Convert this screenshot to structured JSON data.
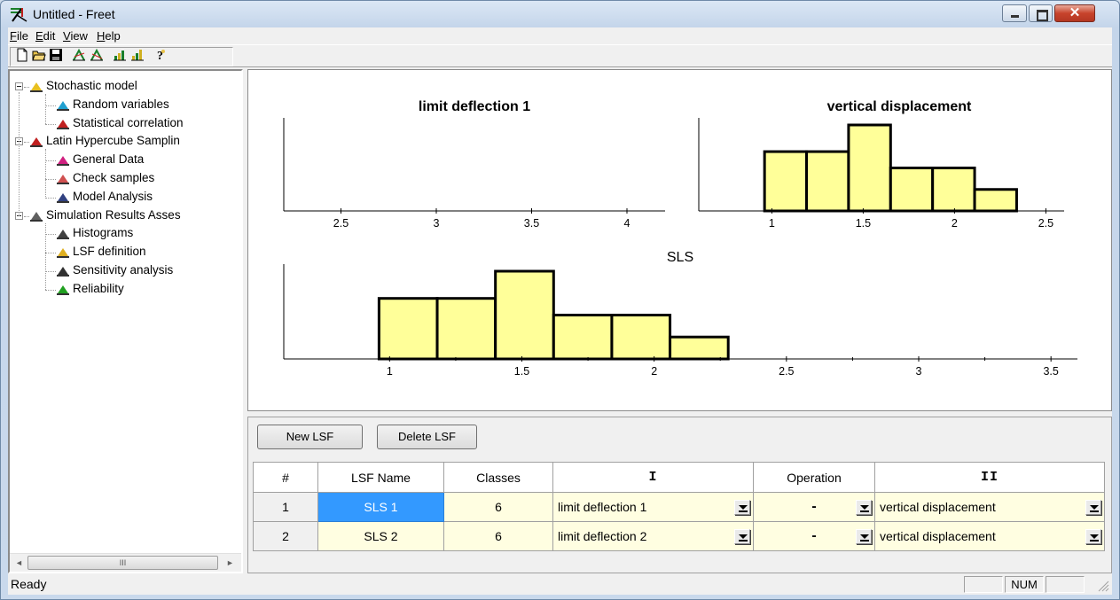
{
  "window": {
    "title": "Untitled - Freet"
  },
  "menu": [
    {
      "label": "File",
      "key": "F",
      "rest": "ile"
    },
    {
      "label": "Edit",
      "key": "E",
      "rest": "dit"
    },
    {
      "label": "View",
      "key": "V",
      "rest": "iew"
    },
    {
      "label": "Help",
      "key": "H",
      "rest": "elp"
    }
  ],
  "toolbar": {
    "icons": [
      "new-file-icon",
      "open-folder-icon",
      "save-icon",
      "deflection-chart-icon",
      "lsf-chart-icon",
      "sampling-chart-icon",
      "results-chart-icon",
      "help-icon"
    ]
  },
  "tree": {
    "items": [
      {
        "label": "Stochastic model",
        "level": 0,
        "icon": "grid-icon"
      },
      {
        "label": "Random variables",
        "level": 1,
        "icon": "distribution-icon"
      },
      {
        "label": "Statistical correlation",
        "level": 1,
        "icon": "correlation-matrix-icon"
      },
      {
        "label": "Latin Hypercube Samplin",
        "level": 0,
        "icon": "sampling-icon"
      },
      {
        "label": "General Data",
        "level": 1,
        "icon": "general-data-icon"
      },
      {
        "label": "Check samples",
        "level": 1,
        "icon": "check-samples-icon"
      },
      {
        "label": "Model Analysis",
        "level": 1,
        "icon": "model-analysis-icon"
      },
      {
        "label": "Simulation Results Asses",
        "level": 0,
        "icon": "results-icon"
      },
      {
        "label": "Histograms",
        "level": 1,
        "icon": "histogram-icon"
      },
      {
        "label": "LSF definition",
        "level": 1,
        "icon": "lsf-icon"
      },
      {
        "label": "Sensitivity analysis",
        "level": 1,
        "icon": "sensitivity-icon"
      },
      {
        "label": "Reliability",
        "level": 1,
        "icon": "reliability-icon"
      }
    ],
    "scroll_thumb": "III"
  },
  "chart_data": [
    {
      "type": "bar",
      "title": "limit deflection 1",
      "xlim": [
        2.2,
        4.2
      ],
      "xticks": [
        "2.5",
        "3",
        "3.5",
        "4"
      ],
      "bins": []
    },
    {
      "type": "bar",
      "title": "vertical displacement",
      "xlim": [
        0.6,
        2.6
      ],
      "xticks": [
        "1",
        "1.5",
        "2",
        "2.5"
      ],
      "bins": [
        {
          "from": 0.96,
          "to": 1.19,
          "height": 0.69
        },
        {
          "from": 1.19,
          "to": 1.42,
          "height": 0.69
        },
        {
          "from": 1.42,
          "to": 1.65,
          "height": 1.0
        },
        {
          "from": 1.65,
          "to": 1.88,
          "height": 0.5
        },
        {
          "from": 1.88,
          "to": 2.11,
          "height": 0.5
        },
        {
          "from": 2.11,
          "to": 2.34,
          "height": 0.25
        }
      ]
    },
    {
      "type": "bar",
      "title": "SLS",
      "xlim": [
        0.6,
        3.6
      ],
      "xticks": [
        "1",
        "1.5",
        "2",
        "2.5",
        "3",
        "3.5"
      ],
      "bins": [
        {
          "from": 0.96,
          "to": 1.18,
          "height": 0.69
        },
        {
          "from": 1.18,
          "to": 1.4,
          "height": 0.69
        },
        {
          "from": 1.4,
          "to": 1.62,
          "height": 1.0
        },
        {
          "from": 1.62,
          "to": 1.84,
          "height": 0.5
        },
        {
          "from": 1.84,
          "to": 2.06,
          "height": 0.5
        },
        {
          "from": 2.06,
          "to": 2.28,
          "height": 0.25
        }
      ]
    }
  ],
  "buttons": {
    "new_lsf": "New LSF",
    "delete_lsf": "Delete LSF"
  },
  "table": {
    "headers": [
      "#",
      "LSF Name",
      "Classes",
      "I",
      "Operation",
      "II"
    ],
    "rows": [
      {
        "num": "1",
        "name": "SLS 1",
        "classes": "6",
        "first": "limit deflection 1",
        "op": "-",
        "second": "vertical displacement",
        "selected": true
      },
      {
        "num": "2",
        "name": "SLS 2",
        "classes": "6",
        "first": "limit deflection 2",
        "op": "-",
        "second": "vertical displacement",
        "selected": false
      }
    ]
  },
  "status": {
    "text": "Ready",
    "num": "NUM"
  },
  "colors": {
    "histogram_fill": "#ffff99",
    "selection": "#3399ff",
    "cell_cream": "#fffee1"
  }
}
